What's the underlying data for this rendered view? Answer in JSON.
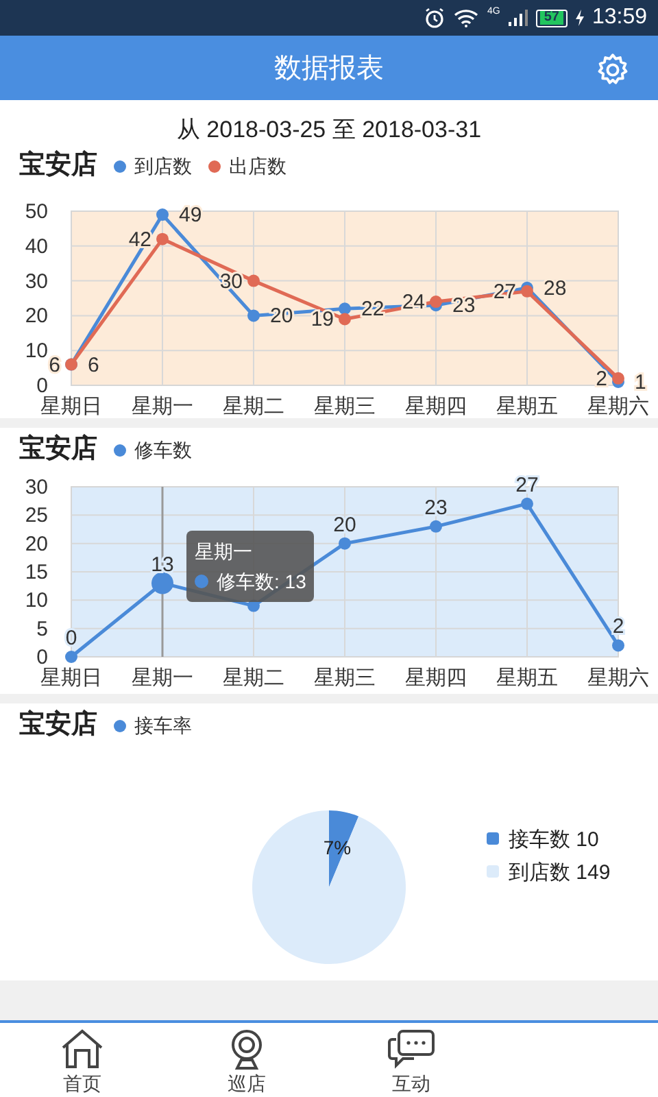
{
  "status_bar": {
    "network": "4G",
    "battery": "57",
    "time": "13:59"
  },
  "header": {
    "title": "数据报表"
  },
  "date_range": "从 2018-03-25 至 2018-03-31",
  "sections": [
    {
      "store": "宝安店",
      "chart_data": {
        "type": "line",
        "categories": [
          "星期日",
          "星期一",
          "星期二",
          "星期三",
          "星期四",
          "星期五",
          "星期六"
        ],
        "ylim": [
          0,
          50
        ],
        "yticks": [
          0,
          10,
          20,
          30,
          40,
          50
        ],
        "grid": true,
        "series": [
          {
            "name": "到店数",
            "color": "#4a8ad8",
            "marker": true,
            "values": [
              6,
              49,
              20,
              22,
              23,
              28,
              1
            ],
            "value_labels": [
              "6",
              "49",
              "20",
              "22",
              "23",
              "28",
              "1"
            ]
          },
          {
            "name": "出店数",
            "color": "#e06a55",
            "marker": true,
            "values": [
              6,
              42,
              30,
              19,
              24,
              27,
              2
            ],
            "value_labels": [
              "6",
              "42",
              "30",
              "19",
              "24",
              "27",
              "2"
            ]
          }
        ]
      }
    },
    {
      "store": "宝安店",
      "chart_data": {
        "type": "line",
        "categories": [
          "星期日",
          "星期一",
          "星期二",
          "星期三",
          "星期四",
          "星期五",
          "星期六"
        ],
        "ylim": [
          0,
          30
        ],
        "yticks": [
          0,
          5,
          10,
          15,
          20,
          25,
          30
        ],
        "grid": true,
        "ref_lines": [
          {
            "axis": "x",
            "value": "星期一",
            "color": "#999999"
          }
        ],
        "series": [
          {
            "name": "修车数",
            "color": "#4a8ad8",
            "marker": true,
            "values": [
              0,
              13,
              9,
              20,
              23,
              27,
              2
            ],
            "value_labels": [
              "0",
              "13",
              null,
              "20",
              "23",
              "27",
              "2"
            ]
          }
        ]
      },
      "tooltip": {
        "title": "星期一",
        "label": "修车数: 13"
      }
    },
    {
      "store": "宝安店",
      "legend_title": "接车率",
      "chart_data": {
        "type": "pie",
        "categories": [
          "接车数 10",
          "到店数 149"
        ],
        "values": [
          10,
          149
        ],
        "colors": [
          "#4a8ad8",
          "#dcebfa"
        ],
        "legend": "right",
        "annotations": [
          "7%"
        ]
      }
    }
  ],
  "nav": [
    {
      "label": "首页",
      "kind": "home"
    },
    {
      "label": "巡店",
      "kind": "camera"
    },
    {
      "label": "互动",
      "kind": "chat"
    }
  ]
}
